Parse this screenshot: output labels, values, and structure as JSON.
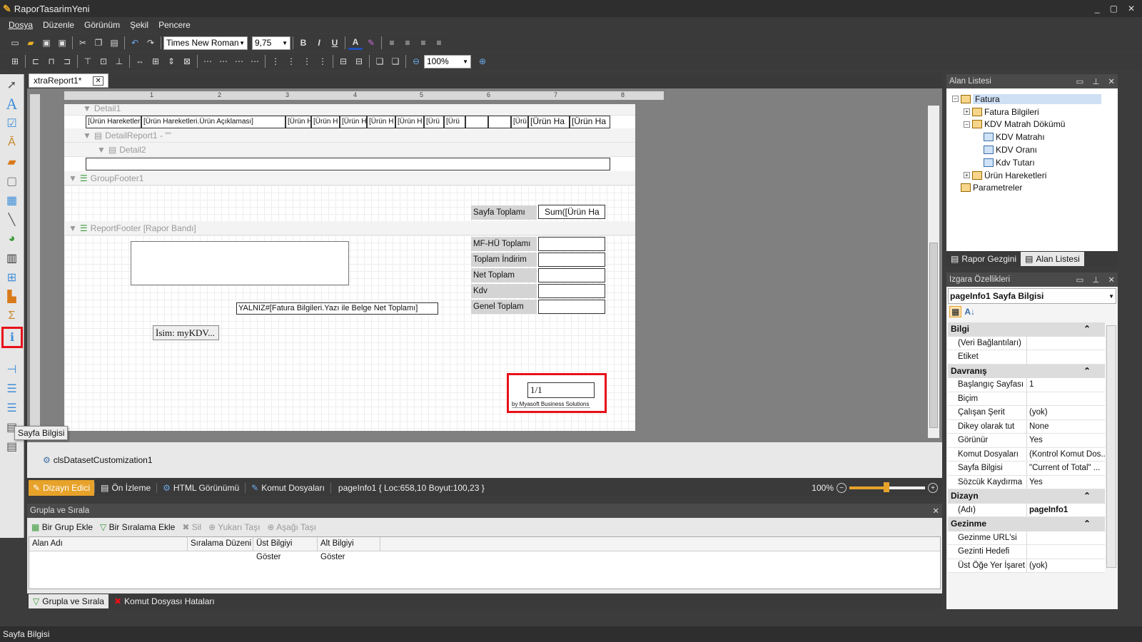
{
  "window": {
    "title": "RaporTasarimYeni",
    "controls": [
      "_",
      "▢",
      "✕"
    ]
  },
  "menu": [
    "Dosya",
    "Düzenle",
    "Görünüm",
    "Şekil",
    "Pencere"
  ],
  "toolbar": {
    "font": "Times New Roman",
    "size": "9,75",
    "zoom": "100%",
    "bold": "B",
    "italic": "I",
    "underline": "U",
    "fontcolor": "A"
  },
  "tooltip": "Sayfa Bilgisi",
  "doc_tab": {
    "label": "xtraReport1*",
    "close": "✕"
  },
  "bands": {
    "detail1": "Detail1",
    "detail_report1": "DetailReport1 - \"\"",
    "detail2": "Detail2",
    "group_footer": "GroupFooter1",
    "report_footer": "ReportFooter [Rapor Bandı]"
  },
  "detail_cells": [
    "[Ürün Hareketleri.Ü",
    "[Ürün Hareketleri.Ürün Açıklaması]",
    "[Ürün H",
    "[Ürün H",
    "[Ürün H",
    "[Ürün H",
    "[Ürün H",
    "[Ürü",
    "[Ürü",
    "[Ürü",
    "[Ürün Ha",
    "[Ürün Ha"
  ],
  "group_footer": {
    "label": "Sayfa Toplamı",
    "value": "Sum([Ürün Ha"
  },
  "footer_labels": [
    "MF-HÜ Toplamı",
    "Toplam İndirim",
    "Net Toplam",
    "Kdv",
    "Genel Toplam"
  ],
  "yalniz": "YALNIZ#[Fatura Bilgileri.Yazı ile Belge Net Toplamı]",
  "isim": "İsim: myKDV...",
  "page_info": "1/1",
  "credit": "by Myasoft Business Solutions",
  "component_tray": "clsDatasetCustomization1",
  "view_tabs": [
    "Dizayn Edici",
    "Ön İzleme",
    "HTML Görünümü",
    "Komut Dosyaları"
  ],
  "status_info": "pageInfo1 { Loc:658,10 Boyut:100,23 }",
  "zoom_status": "100%",
  "group_panel": {
    "title": "Grupla ve Sırala",
    "buttons": [
      "Bir Grup Ekle",
      "Bir Sıralama Ekle",
      "Sil",
      "Yukarı Taşı",
      "Aşağı Taşı"
    ],
    "columns": [
      "Alan Adı",
      "Sıralama Düzeni",
      "Üst Bilgiyi Göster",
      "Alt Bilgiyi Göster"
    ]
  },
  "bottom_tabs": [
    "Grupla ve Sırala",
    "Komut Dosyası Hataları"
  ],
  "field_list": {
    "title": "Alan Listesi",
    "tree": [
      {
        "label": "Fatura",
        "level": 0,
        "exp": "−",
        "sel": true
      },
      {
        "label": "Fatura Bilgileri",
        "level": 1,
        "exp": "+"
      },
      {
        "label": "KDV Matrah Dökümü",
        "level": 1,
        "exp": "−"
      },
      {
        "label": "KDV Matrahı",
        "level": 2,
        "exp": ""
      },
      {
        "label": "KDV Oranı",
        "level": 2,
        "exp": ""
      },
      {
        "label": "Kdv Tutarı",
        "level": 2,
        "exp": ""
      },
      {
        "label": "Ürün Hareketleri",
        "level": 1,
        "exp": "+"
      },
      {
        "label": "Parametreler",
        "level": 0,
        "exp": ""
      }
    ],
    "tabs": [
      "Rapor Gezgini",
      "Alan Listesi"
    ]
  },
  "props": {
    "title": "Izgara Özellikleri",
    "object": "pageInfo1  Sayfa Bilgisi",
    "cat_bilgi": "Bilgi",
    "rows_bilgi": [
      [
        "(Veri Bağlantıları)",
        ""
      ],
      [
        "Etiket",
        ""
      ]
    ],
    "cat_davranis": "Davranış",
    "rows_davranis": [
      [
        "Başlangıç Sayfası",
        "1"
      ],
      [
        "Biçim",
        ""
      ],
      [
        "Çalışan Şerit",
        "(yok)"
      ],
      [
        "Dikey olarak tut",
        "None"
      ],
      [
        "Görünür",
        "Yes"
      ],
      [
        "Komut Dosyaları",
        "(Kontrol Komut Dos..."
      ],
      [
        "Sayfa Bilgisi",
        "\"Current of Total\" ..."
      ],
      [
        "Sözcük Kaydırma",
        "Yes"
      ]
    ],
    "cat_dizayn": "Dizayn",
    "rows_dizayn": [
      [
        "(Adı)",
        "pageInfo1"
      ]
    ],
    "cat_gezinme": "Gezinme",
    "rows_gezinme": [
      [
        "Gezinme URL'si",
        ""
      ],
      [
        "Gezinti Hedefi",
        ""
      ],
      [
        "Üst Öğe Yer İşaret",
        "(yok)"
      ]
    ]
  },
  "status": "Sayfa Bilgisi"
}
